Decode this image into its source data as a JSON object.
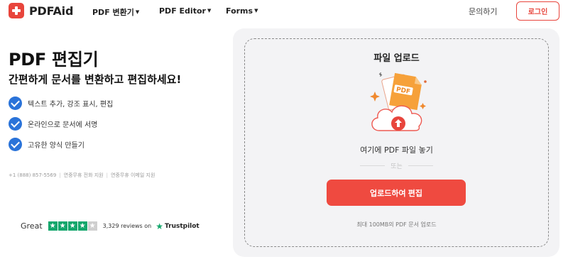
{
  "header": {
    "brand": "PDFAid",
    "nav": [
      {
        "label": "PDF 변환기"
      },
      {
        "label": "PDF Editor"
      },
      {
        "label": "Forms"
      }
    ],
    "contact": "문의하기",
    "login": "로그인"
  },
  "hero": {
    "title": "PDF 편집기",
    "subtitle": "간편하게 문서를 변환하고 편집하세요!",
    "features": [
      "텍스트 추가, 강조 표시, 편집",
      "온라인으로 문서에 서명",
      "고유한 양식 만들기"
    ],
    "support": [
      "+1 (888) 857-5569",
      "연중무휴 전화 지원",
      "연중무휴 이메일 지원"
    ]
  },
  "trust": {
    "label": "Great",
    "stars_filled": 4,
    "stars_total": 5,
    "reviews": "3,329 reviews on",
    "brand": "Trustpilot"
  },
  "upload": {
    "title": "파일 업로드",
    "illustration_label": "PDF",
    "drop_text": "여기에 PDF 파일 놓기",
    "or": "또는",
    "button": "업로드하여 편집",
    "limit": "최대 100MB의 PDF 문서 업로드"
  },
  "colors": {
    "accent": "#e8453c",
    "check": "#2a73d9",
    "trustpilot": "#14a76c"
  }
}
